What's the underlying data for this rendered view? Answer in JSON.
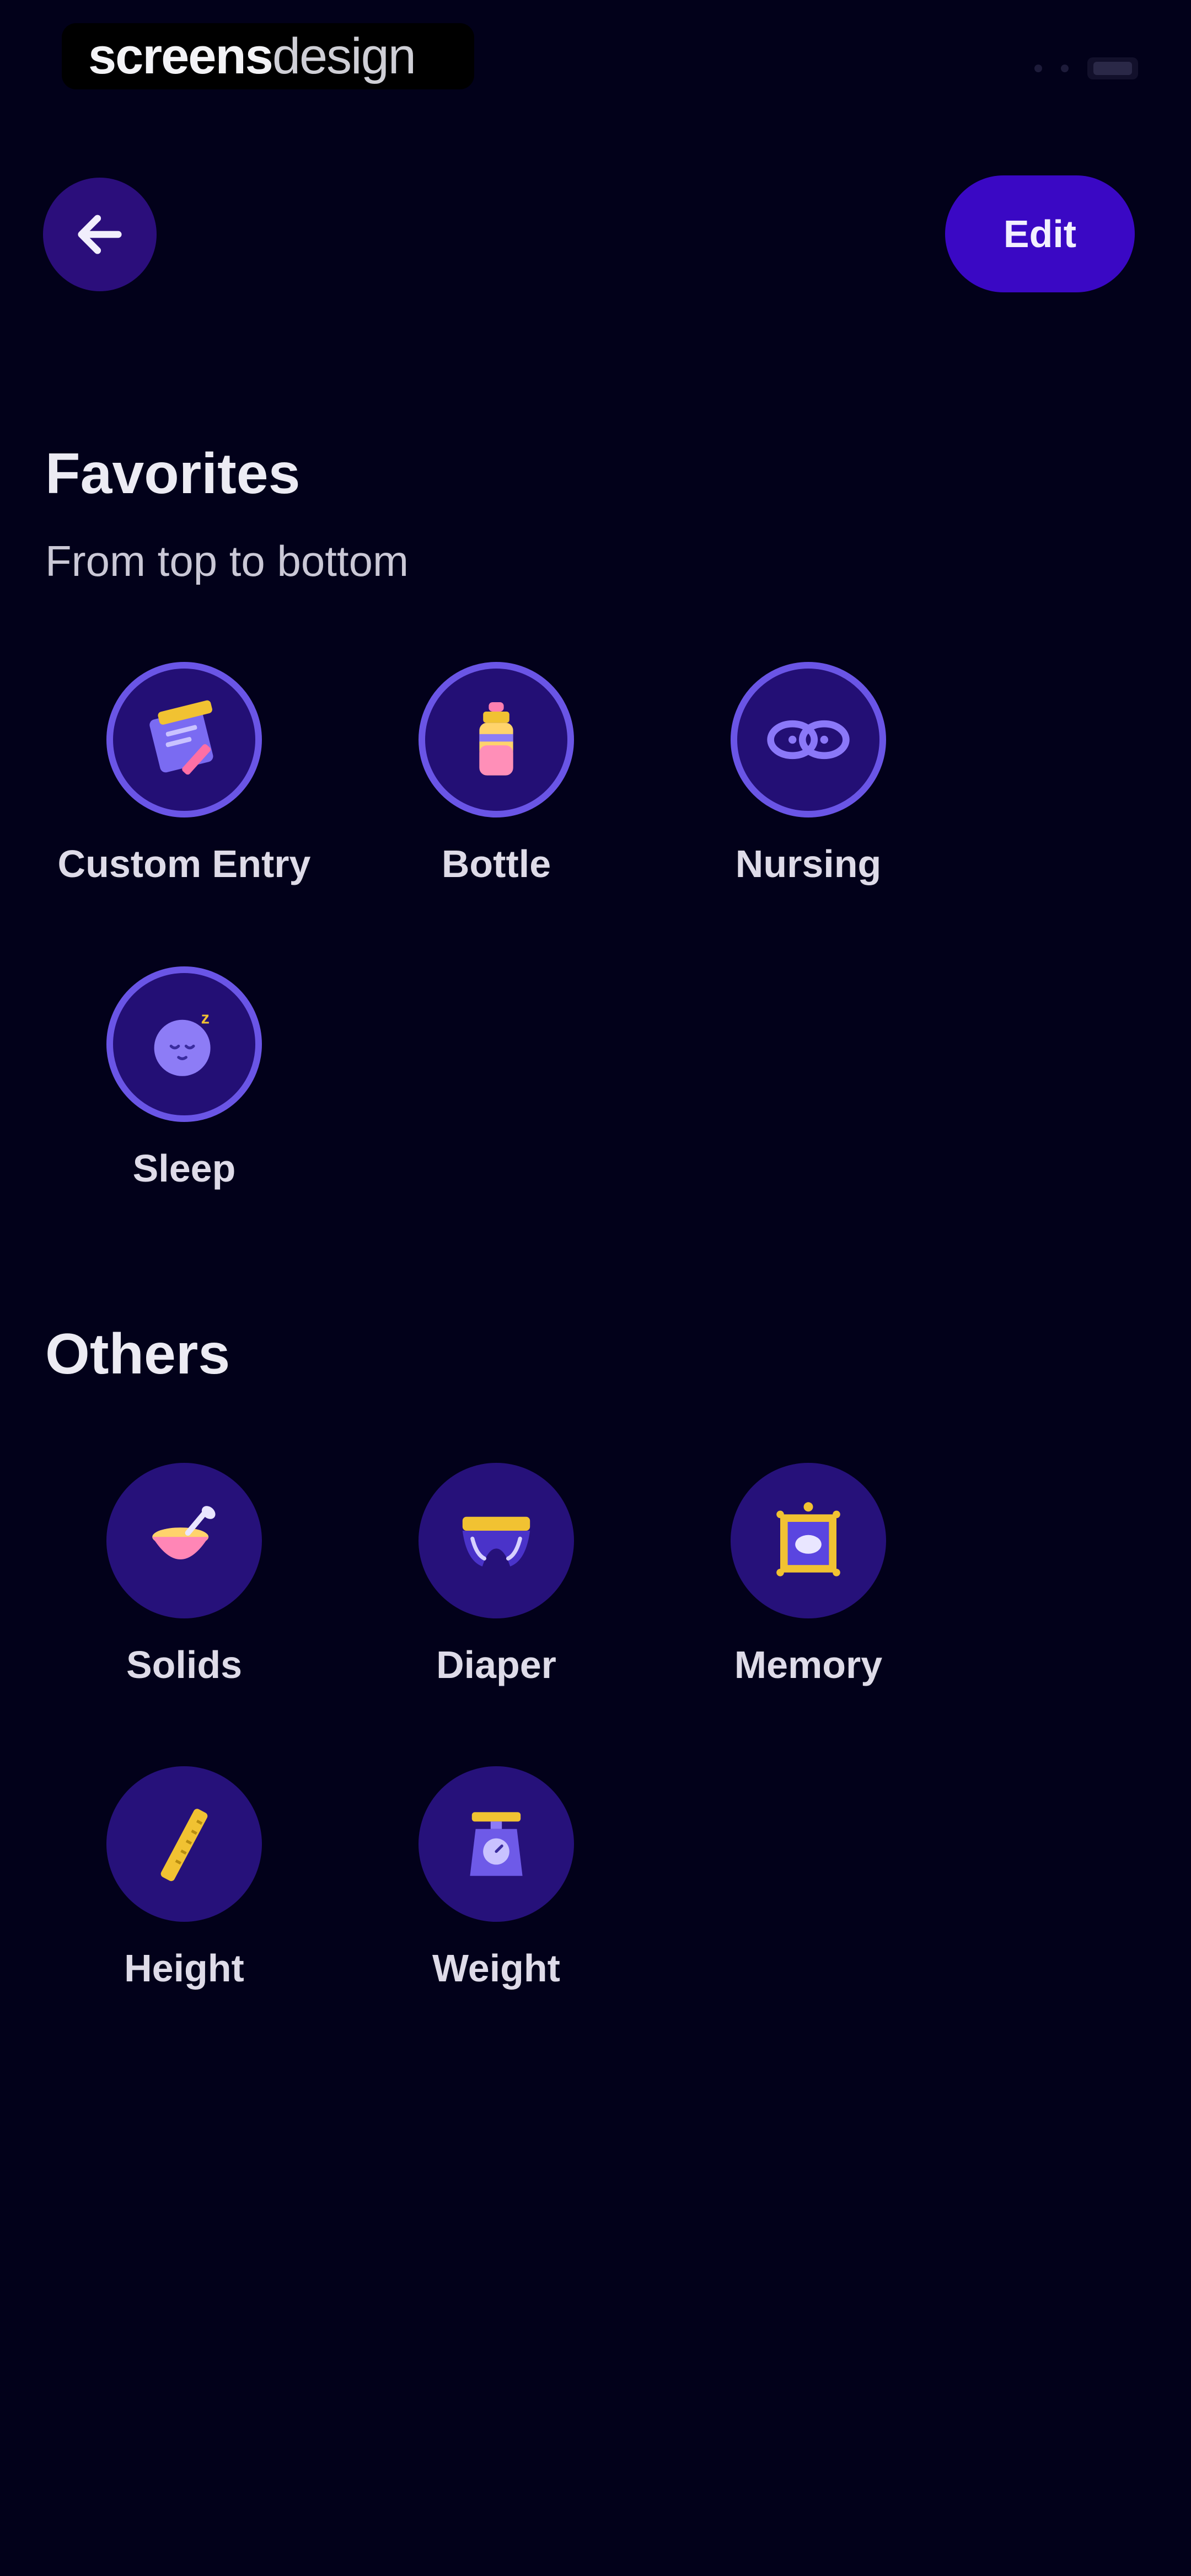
{
  "watermark": {
    "bold": "screens",
    "light": "design"
  },
  "header": {
    "edit_label": "Edit"
  },
  "favorites": {
    "title": "Favorites",
    "subtitle": "From top to bottom",
    "items": [
      {
        "label": "Custom Entry",
        "icon": "custom-entry-icon"
      },
      {
        "label": "Bottle",
        "icon": "bottle-icon"
      },
      {
        "label": "Nursing",
        "icon": "nursing-icon"
      },
      {
        "label": "Sleep",
        "icon": "sleep-icon"
      }
    ]
  },
  "others": {
    "title": "Others",
    "items": [
      {
        "label": "Solids",
        "icon": "solids-icon"
      },
      {
        "label": "Diaper",
        "icon": "diaper-icon"
      },
      {
        "label": "Memory",
        "icon": "memory-icon"
      },
      {
        "label": "Height",
        "icon": "height-icon"
      },
      {
        "label": "Weight",
        "icon": "weight-icon"
      }
    ]
  },
  "colors": {
    "background": "#02011a",
    "accent": "#3a08c4",
    "circle": "#26117a",
    "ring": "#6a55e6"
  }
}
